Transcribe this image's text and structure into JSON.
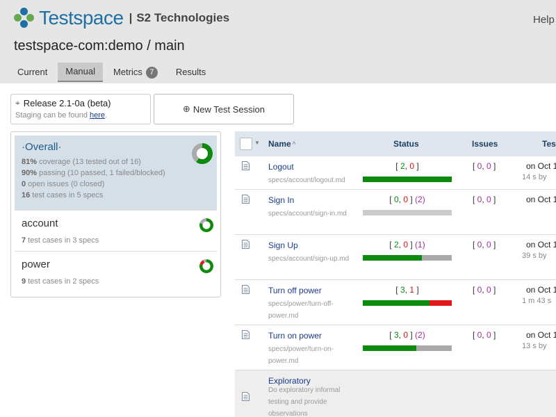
{
  "colors": {
    "pass": "#0b8a0b",
    "fail": "#e01a1a",
    "untested": "#aaaaaa",
    "empty": "#cccccc",
    "brand": "#1d6fa5"
  },
  "header": {
    "logo_name": "Testspace",
    "logo_sep": "|",
    "company": "S2 Technologies",
    "help": "Help",
    "project_title": "testspace-com:demo / main"
  },
  "tabs": [
    {
      "label": "Current"
    },
    {
      "label": "Manual",
      "active": true
    },
    {
      "label": "Metrics",
      "badge": "7"
    },
    {
      "label": "Results"
    }
  ],
  "release": {
    "icon": "crosshair-icon",
    "name": "Release 2.1-0a (beta)",
    "sub_prefix": "Staging can be found ",
    "sub_link": "here",
    "sub_suffix": "."
  },
  "new_session": {
    "icon": "plus-circle-icon",
    "label": "New Test Session"
  },
  "specs": {
    "overall": {
      "title": "·Overall·",
      "coverage_pct": "81%",
      "coverage_text": " coverage (13 tested out of 16)",
      "passing_pct": "90%",
      "passing_text": " passing (10 passed, 1 failed/blocked)",
      "issues_count": "0",
      "issues_text": " open issues (0 closed)",
      "cases_count": "16",
      "cases_text": " test cases in 5 specs",
      "donut": {
        "pass": 0.6,
        "fail": 0.0,
        "untested": 0.4
      }
    },
    "account": {
      "title": "account",
      "cases_count": "7",
      "cases_text": " test cases in 3 specs",
      "donut": {
        "pass": 0.8,
        "fail": 0.0,
        "untested": 0.2
      }
    },
    "power": {
      "title": "power",
      "cases_count": "9",
      "cases_text": " test cases in 2 specs",
      "donut": {
        "pass": 0.8,
        "fail": 0.12,
        "untested": 0.08
      }
    }
  },
  "table": {
    "headers": {
      "name": "Name",
      "sort": "^",
      "status": "Status",
      "issues": "Issues",
      "tested": "Tes"
    },
    "rows": [
      {
        "name": "Logout",
        "path": "specs/account/logout.md",
        "passed": "2",
        "failed": "0",
        "untested": "",
        "bar": {
          "pass": 1.0,
          "fail": 0.0,
          "untested": 0.0
        },
        "issues_open": "0",
        "issues_closed": "0",
        "date": "on Oct 1",
        "duration": "14 s by"
      },
      {
        "name": "Sign In",
        "path": "specs/account/sign-in.md",
        "passed": "0",
        "failed": "0",
        "untested": "2",
        "bar": {
          "pass": 0.0,
          "fail": 0.0,
          "untested": 0.0
        },
        "issues_open": "0",
        "issues_closed": "0",
        "date": "on Oct 1",
        "duration": ""
      },
      {
        "name": "Sign Up",
        "path": "specs/account/sign-up.md",
        "passed": "2",
        "failed": "0",
        "untested": "1",
        "bar": {
          "pass": 0.667,
          "fail": 0.0,
          "untested": 0.333
        },
        "issues_open": "0",
        "issues_closed": "0",
        "date": "on Oct 1",
        "duration": "39 s by"
      },
      {
        "name": "Turn off power",
        "path": "specs/power/turn-off-power.md",
        "passed": "3",
        "failed": "1",
        "untested": "",
        "bar": {
          "pass": 0.75,
          "fail": 0.25,
          "untested": 0.0
        },
        "issues_open": "0",
        "issues_closed": "0",
        "date": "on Oct 1",
        "duration": "1 m 43 s"
      },
      {
        "name": "Turn on power",
        "path": "specs/power/turn-on-power.md",
        "passed": "3",
        "failed": "0",
        "untested": "2",
        "bar": {
          "pass": 0.6,
          "fail": 0.0,
          "untested": 0.4
        },
        "issues_open": "0",
        "issues_closed": "0",
        "date": "on Oct 1",
        "duration": "13 s by"
      }
    ],
    "exploratory": {
      "name": "Exploratory",
      "desc": "Do exploratory informal testing and provide observations"
    }
  }
}
